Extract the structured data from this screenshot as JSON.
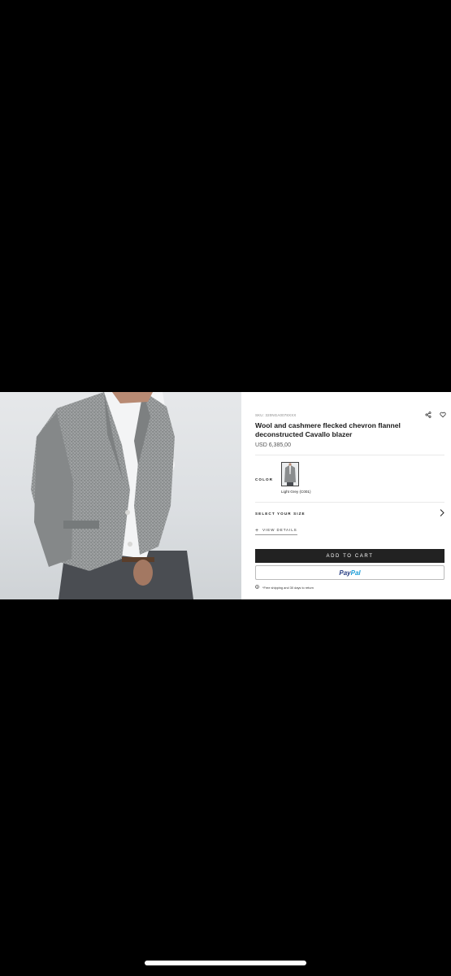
{
  "product": {
    "sku": "SKU: 320NGA0078XXX",
    "title": "Wool and cashmere flecked chevron flannel deconstructed Cavallo blazer",
    "price": "USD 6,385,00"
  },
  "color": {
    "label": "COLOR",
    "selected_name": "Light Grey (C001)"
  },
  "size": {
    "label": "SELECT YOUR SIZE"
  },
  "details": {
    "plus": "+",
    "label": "VIEW DETAILS"
  },
  "actions": {
    "add_to_cart": "ADD TO CART",
    "paypal_pay": "Pay",
    "paypal_pal": "Pal"
  },
  "shipping": {
    "text": "*Free shipping and 30 days to return"
  },
  "icons": {
    "share": "share-icon",
    "wishlist": "heart-icon",
    "chevron": "chevron-right-icon",
    "shipping": "info-circle-icon"
  },
  "colors": {
    "background": "#000000",
    "page": "#ffffff",
    "button_dark": "#222222",
    "paypal_blue_dark": "#253b80",
    "paypal_blue_light": "#179bd7"
  }
}
